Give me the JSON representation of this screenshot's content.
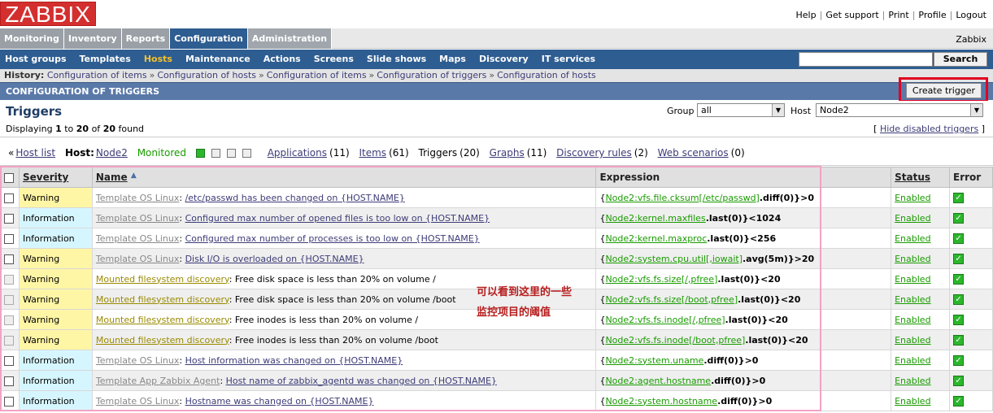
{
  "logo": "ZABBIX",
  "top_links": [
    "Help",
    "Get support",
    "Print",
    "Profile",
    "Logout"
  ],
  "main_menu": [
    "Monitoring",
    "Inventory",
    "Reports",
    "Configuration",
    "Administration"
  ],
  "server_name": "Zabbix",
  "sub_menu": [
    "Host groups",
    "Templates",
    "Hosts",
    "Maintenance",
    "Actions",
    "Screens",
    "Slide shows",
    "Maps",
    "Discovery",
    "IT services"
  ],
  "search_button": "Search",
  "history": {
    "label": "History:",
    "items": [
      "Configuration of items",
      "Configuration of hosts",
      "Configuration of items",
      "Configuration of triggers",
      "Configuration of hosts"
    ]
  },
  "config_title": "CONFIGURATION OF TRIGGERS",
  "create_button": "Create trigger",
  "panel": {
    "title": "Triggers",
    "displaying_pre": "Displaying",
    "from": "1",
    "to_word": "to",
    "to": "20",
    "of_word": "of",
    "total": "20",
    "found": "found",
    "group_label": "Group",
    "group_value": "all",
    "host_label": "Host",
    "host_value": "Node2",
    "hide_disabled": "Hide disabled triggers",
    "bracket_l": "[",
    "bracket_r": "]"
  },
  "host_nav": {
    "back": "«",
    "host_list": "Host list",
    "host_label": "Host:",
    "host": "Node2",
    "monitored": "Monitored",
    "applications": "Applications",
    "applications_count": "(11)",
    "items": "Items",
    "items_count": "(61)",
    "triggers": "Triggers",
    "triggers_count": "(20)",
    "graphs": "Graphs",
    "graphs_count": "(11)",
    "discovery": "Discovery rules",
    "discovery_count": "(2)",
    "web": "Web scenarios",
    "web_count": "(0)"
  },
  "table": {
    "headers": {
      "severity": "Severity",
      "name": "Name",
      "expression": "Expression",
      "status": "Status",
      "error": "Error"
    },
    "rows": [
      {
        "severity": "Warning",
        "template": "Template OS Linux",
        "name": "/etc/passwd has been changed on {HOST.NAME}",
        "expr_key": "Node2:vfs.file.cksum[/etc/passwd]",
        "expr_fn": ".diff(0)}>0",
        "status": "Enabled"
      },
      {
        "severity": "Information",
        "template": "Template OS Linux",
        "name": "Configured max number of opened files is too low on {HOST.NAME}",
        "expr_key": "Node2:kernel.maxfiles",
        "expr_fn": ".last(0)}<1024",
        "status": "Enabled"
      },
      {
        "severity": "Information",
        "template": "Template OS Linux",
        "name": "Configured max number of processes is too low on {HOST.NAME}",
        "expr_key": "Node2:kernel.maxproc",
        "expr_fn": ".last(0)}<256",
        "status": "Enabled"
      },
      {
        "severity": "Warning",
        "template": "Template OS Linux",
        "name": "Disk I/O is overloaded on {HOST.NAME}",
        "expr_key": "Node2:system.cpu.util[,iowait]",
        "expr_fn": ".avg(5m)}>20",
        "status": "Enabled"
      },
      {
        "severity": "Warning",
        "template": "Mounted filesystem discovery",
        "name": "Free disk space is less than 20% on volume /",
        "expr_key": "Node2:vfs.fs.size[/,pfree]",
        "expr_fn": ".last(0)}<20",
        "status": "Enabled"
      },
      {
        "severity": "Warning",
        "template": "Mounted filesystem discovery",
        "name": "Free disk space is less than 20% on volume /boot",
        "expr_key": "Node2:vfs.fs.size[/boot,pfree]",
        "expr_fn": ".last(0)}<20",
        "status": "Enabled"
      },
      {
        "severity": "Warning",
        "template": "Mounted filesystem discovery",
        "name": "Free inodes is less than 20% on volume /",
        "expr_key": "Node2:vfs.fs.inode[/,pfree]",
        "expr_fn": ".last(0)}<20",
        "status": "Enabled"
      },
      {
        "severity": "Warning",
        "template": "Mounted filesystem discovery",
        "name": "Free inodes is less than 20% on volume /boot",
        "expr_key": "Node2:vfs.fs.inode[/boot,pfree]",
        "expr_fn": ".last(0)}<20",
        "status": "Enabled"
      },
      {
        "severity": "Information",
        "template": "Template OS Linux",
        "name": "Host information was changed on {HOST.NAME}",
        "expr_key": "Node2:system.uname",
        "expr_fn": ".diff(0)}>0",
        "status": "Enabled"
      },
      {
        "severity": "Information",
        "template": "Template App Zabbix Agent",
        "name": "Host name of zabbix_agentd was changed on {HOST.NAME}",
        "expr_key": "Node2:agent.hostname",
        "expr_fn": ".diff(0)}>0",
        "status": "Enabled"
      },
      {
        "severity": "Information",
        "template": "Template OS Linux",
        "name": "Hostname was changed on {HOST.NAME}",
        "expr_key": "Node2:system.hostname",
        "expr_fn": ".diff(0)}>0",
        "status": "Enabled"
      }
    ]
  },
  "annotation": [
    "可以看到这里的一些",
    "监控项目的阈值"
  ],
  "colors": {
    "brand_red": "#d32f2f",
    "nav_blue": "#2e5d91",
    "warning": "#fff6a5",
    "information": "#d6f6ff",
    "enabled": "#199b00",
    "annotation_box": "#f4a2c4",
    "highlight_box": "#e00020"
  }
}
